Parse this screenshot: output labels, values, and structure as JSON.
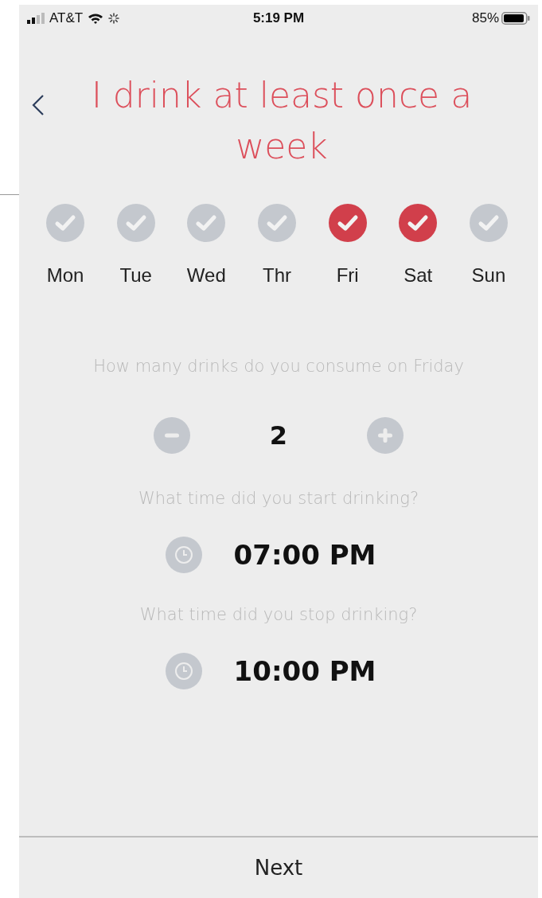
{
  "status_bar": {
    "carrier": "AT&T",
    "time": "5:19 PM",
    "battery": "85%"
  },
  "title": "I drink at least once a week",
  "days": [
    {
      "label": "Mon",
      "selected": false
    },
    {
      "label": "Tue",
      "selected": false
    },
    {
      "label": "Wed",
      "selected": false
    },
    {
      "label": "Thr",
      "selected": false
    },
    {
      "label": "Fri",
      "selected": true
    },
    {
      "label": "Sat",
      "selected": true
    },
    {
      "label": "Sun",
      "selected": false
    }
  ],
  "drinks_question": "How many drinks do you consume on Friday",
  "drinks_count": "2",
  "start_question": "What time did you start drinking?",
  "start_time": "07:00 PM",
  "stop_question": "What time did you stop drinking?",
  "stop_time": "10:00 PM",
  "next_button": "Next"
}
